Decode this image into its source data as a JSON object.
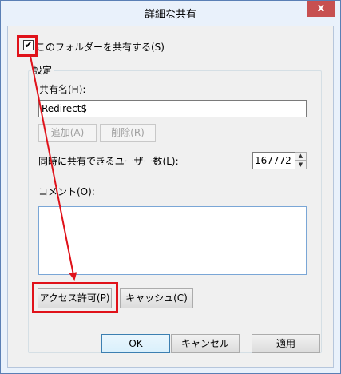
{
  "dialog": {
    "title": "詳細な共有",
    "close_glyph": "x",
    "share_checkbox": {
      "label": "このフォルダーを共有する(S)",
      "checked": true,
      "check_glyph": "✔"
    },
    "settings": {
      "title": "設定",
      "share_name_label": "共有名(H):",
      "share_name_value": "Redirect$",
      "add_button": "追加(A)",
      "remove_button": "削除(R)",
      "user_limit_label": "同時に共有できるユーザー数(L):",
      "user_limit_value": "167772",
      "spinner_up_glyph": "▲",
      "spinner_down_glyph": "▼",
      "comment_label": "コメント(O):",
      "comment_value": "",
      "permissions_button": "アクセス許可(P)",
      "caching_button": "キャッシュ(C)"
    },
    "footer": {
      "ok_button": "OK",
      "cancel_button": "キャンセル",
      "apply_button": "適用"
    }
  },
  "colors": {
    "highlight": "#e0121a",
    "close_button": "#c75050",
    "window_frame": "#e9f1fb"
  }
}
